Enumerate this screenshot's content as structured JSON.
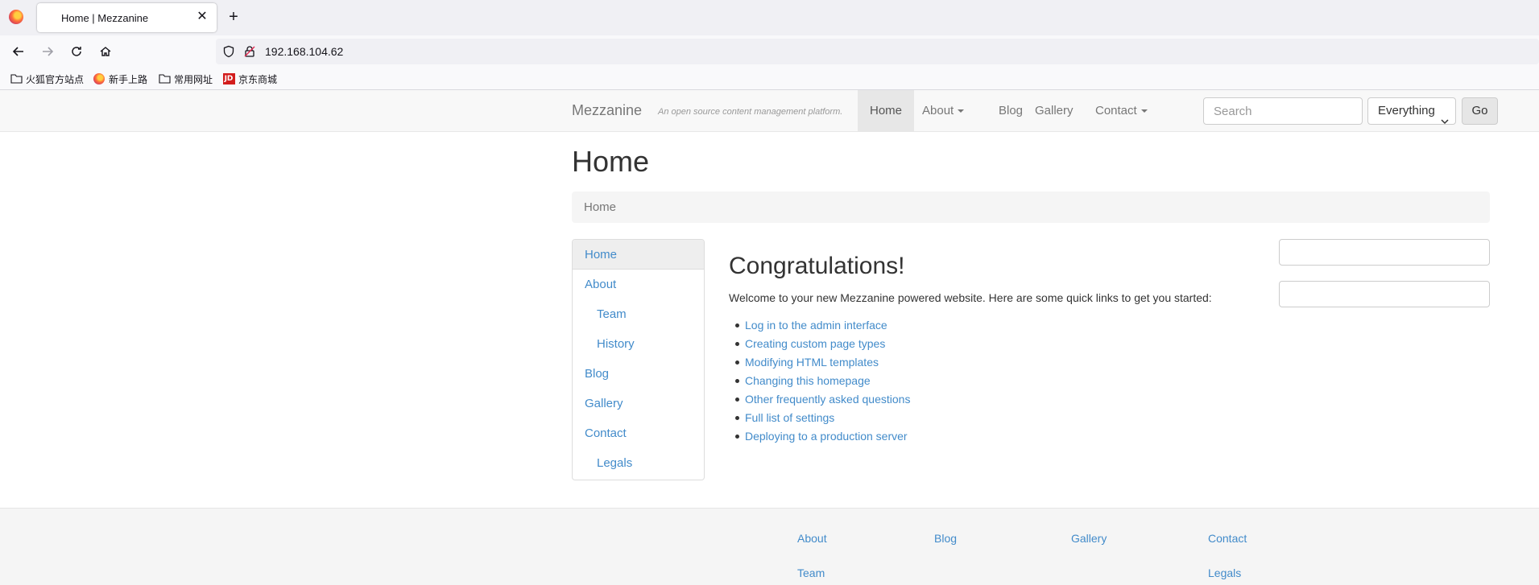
{
  "browser": {
    "tab_title": "Home | Mezzanine",
    "url": "192.168.104.62",
    "bookmarks": [
      "火狐官方站点",
      "新手上路",
      "常用网址",
      "京东商城"
    ],
    "jd_badge": "JD"
  },
  "site": {
    "brand": "Mezzanine",
    "tagline": "An open source content management platform.",
    "nav": {
      "home": "Home",
      "about": "About",
      "blog": "Blog",
      "gallery": "Gallery",
      "contact": "Contact"
    },
    "search": {
      "placeholder": "Search",
      "scope": "Everything",
      "go": "Go"
    }
  },
  "page": {
    "title": "Home",
    "breadcrumb": "Home",
    "leftnav": [
      "Home",
      "About",
      "Team",
      "History",
      "Blog",
      "Gallery",
      "Contact",
      "Legals"
    ],
    "heading": "Congratulations!",
    "welcome": "Welcome to your new Mezzanine powered website. Here are some quick links to get you started:",
    "links": [
      "Log in to the admin interface",
      "Creating custom page types",
      "Modifying HTML templates",
      "Changing this homepage",
      "Other frequently asked questions",
      "Full list of settings",
      "Deploying to a production server"
    ]
  },
  "footer": {
    "about": "About",
    "team": "Team",
    "blog": "Blog",
    "gallery": "Gallery",
    "contact": "Contact",
    "legals": "Legals"
  },
  "colors": {
    "link": "#428bca",
    "navbar_bg": "#f8f8f8",
    "active_nav_bg": "#e7e7e7"
  }
}
